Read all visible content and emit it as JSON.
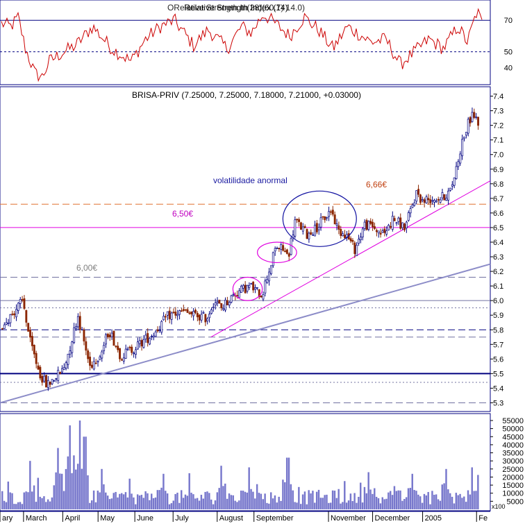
{
  "colors": {
    "frame": "#000080",
    "rsi_line": "#cc0000",
    "candle_up_body": "#ffffff",
    "candle_up_outline": "#000080",
    "candle_down": "#8b2500",
    "volume": "#7777cc",
    "trend_magenta": "#e000e0",
    "trend_blue": "#8c8cc8",
    "orange_dash": "#e07030",
    "level_gray": "#7070a0",
    "ellipse_blue": "#1010a0",
    "text_annot_blue": "#1a1aa0",
    "text_magenta": "#c000c0",
    "text_orange": "#c04010",
    "text_gray": "#808080"
  },
  "chart_data": [
    {
      "type": "line",
      "title": "Relative Strength Index (14)",
      "overlap_title": "ORelative Strength In(28)(60.7) 14.0)",
      "yticks": [
        40,
        50,
        70
      ],
      "ylim": [
        30,
        82
      ],
      "ref_lines": [
        70,
        50
      ],
      "anchors_x": [
        0,
        0.02,
        0.035,
        0.05,
        0.07,
        0.085,
        0.1,
        0.13,
        0.155,
        0.19,
        0.23,
        0.27,
        0.3,
        0.33,
        0.36,
        0.4,
        0.43,
        0.47,
        0.5,
        0.52,
        0.545,
        0.57,
        0.6,
        0.63,
        0.66,
        0.69,
        0.72,
        0.75,
        0.77,
        0.8,
        0.83,
        0.86,
        0.89,
        0.92,
        0.95,
        0.97,
        0.99,
        1.0
      ],
      "anchors_y": [
        68,
        66,
        72,
        52,
        36,
        34,
        44,
        50,
        54,
        66,
        52,
        44,
        58,
        66,
        70,
        54,
        64,
        52,
        66,
        62,
        74,
        68,
        60,
        72,
        64,
        52,
        66,
        60,
        56,
        58,
        42,
        50,
        58,
        52,
        66,
        56,
        76,
        68
      ]
    },
    {
      "type": "candlestick",
      "title": "BRISA-PRIV (7.25000, 7.25000, 7.18000, 7.21000, +0.03000)",
      "yticks": [
        5.3,
        5.4,
        5.5,
        5.6,
        5.7,
        5.8,
        5.9,
        6.0,
        6.1,
        6.2,
        6.3,
        6.4,
        6.5,
        6.6,
        6.7,
        6.8,
        6.9,
        7.0,
        7.1,
        7.2,
        7.3,
        7.4
      ],
      "ylim": [
        5.25,
        7.45
      ],
      "xlabels": [
        "ary",
        "March",
        "April",
        "May",
        "June",
        "July",
        "August",
        "September",
        "November",
        "December",
        "2005",
        "Fe"
      ],
      "xlabel_positions": [
        0.0,
        0.048,
        0.128,
        0.2,
        0.275,
        0.353,
        0.443,
        0.518,
        0.67,
        0.76,
        0.862,
        0.972
      ],
      "num_candles": 240,
      "anchors_x": [
        0,
        0.025,
        0.045,
        0.06,
        0.08,
        0.095,
        0.13,
        0.145,
        0.16,
        0.185,
        0.21,
        0.225,
        0.25,
        0.28,
        0.32,
        0.35,
        0.38,
        0.43,
        0.445,
        0.46,
        0.49,
        0.52,
        0.545,
        0.575,
        0.59,
        0.6,
        0.615,
        0.64,
        0.66,
        0.69,
        0.705,
        0.72,
        0.74,
        0.76,
        0.78,
        0.8,
        0.82,
        0.845,
        0.87,
        0.88,
        0.9,
        0.92,
        0.94,
        0.955,
        0.965,
        0.985,
        1.0
      ],
      "anchors_y": [
        5.82,
        5.92,
        6.0,
        5.72,
        5.5,
        5.42,
        5.53,
        5.7,
        5.9,
        5.55,
        5.65,
        5.8,
        5.62,
        5.68,
        5.78,
        5.9,
        5.92,
        5.88,
        6.0,
        5.95,
        6.05,
        6.1,
        6.04,
        6.37,
        6.35,
        6.3,
        6.55,
        6.45,
        6.5,
        6.62,
        6.48,
        6.46,
        6.35,
        6.52,
        6.5,
        6.45,
        6.56,
        6.5,
        6.75,
        6.68,
        6.7,
        6.7,
        6.75,
        6.95,
        7.1,
        7.28,
        7.21
      ],
      "levels": [
        {
          "value": 6.0,
          "style": "solid",
          "color": "level_gray"
        },
        {
          "value": 5.5,
          "style": "solid",
          "color": "frame"
        },
        {
          "value": 6.5,
          "style": "solid",
          "color": "trend_magenta"
        },
        {
          "value": 6.66,
          "style": "dash",
          "color": "orange_dash"
        },
        {
          "value": 5.8,
          "style": "dash",
          "color": "frame"
        },
        {
          "value": 5.75,
          "style": "dash",
          "color": "level_gray"
        },
        {
          "value": 6.16,
          "style": "dash",
          "color": "level_gray"
        },
        {
          "value": 5.95,
          "style": "dot",
          "color": "level_gray"
        },
        {
          "value": 5.44,
          "style": "dot",
          "color": "level_gray"
        },
        {
          "value": 5.3,
          "style": "dash",
          "color": "level_gray"
        }
      ],
      "trendlines": [
        {
          "from": [
            0.0,
            5.3
          ],
          "to": [
            1.0,
            6.25
          ],
          "color": "trend_blue"
        },
        {
          "from": [
            0.43,
            5.75
          ],
          "to": [
            1.0,
            6.82
          ],
          "color": "trend_magenta"
        }
      ],
      "ellipses": [
        {
          "cx": 0.505,
          "cy": 6.08,
          "rx": 0.03,
          "ry": 0.08,
          "color": "trend_magenta"
        },
        {
          "cx": 0.565,
          "cy": 6.33,
          "rx": 0.04,
          "ry": 0.07,
          "color": "trend_magenta"
        },
        {
          "cx": 0.652,
          "cy": 6.56,
          "rx": 0.075,
          "ry": 0.19,
          "color": "ellipse_blue"
        }
      ],
      "annotations": {
        "six": "6,00€",
        "six_fifty": "6,50€",
        "six_sixtysix": "6,66€",
        "abnormal": "volatilidade anormal"
      }
    },
    {
      "type": "bar",
      "title": "",
      "yticks": [
        5000,
        10000,
        15000,
        20000,
        25000,
        30000,
        35000,
        40000,
        45000,
        50000,
        55000
      ],
      "ylim": [
        0,
        58000
      ],
      "unit_label": "x100",
      "num_bars": 240,
      "spikes": [
        {
          "x": 0.06,
          "v": 30000
        },
        {
          "x": 0.12,
          "v": 38000
        },
        {
          "x": 0.145,
          "v": 52000
        },
        {
          "x": 0.165,
          "v": 55000
        },
        {
          "x": 0.175,
          "v": 45000
        },
        {
          "x": 0.21,
          "v": 25000
        },
        {
          "x": 0.34,
          "v": 22000
        },
        {
          "x": 0.46,
          "v": 27000
        },
        {
          "x": 0.52,
          "v": 26000
        },
        {
          "x": 0.6,
          "v": 32000
        },
        {
          "x": 0.77,
          "v": 23000
        },
        {
          "x": 0.86,
          "v": 22000
        },
        {
          "x": 0.93,
          "v": 25000
        },
        {
          "x": 0.985,
          "v": 26000
        }
      ]
    }
  ]
}
